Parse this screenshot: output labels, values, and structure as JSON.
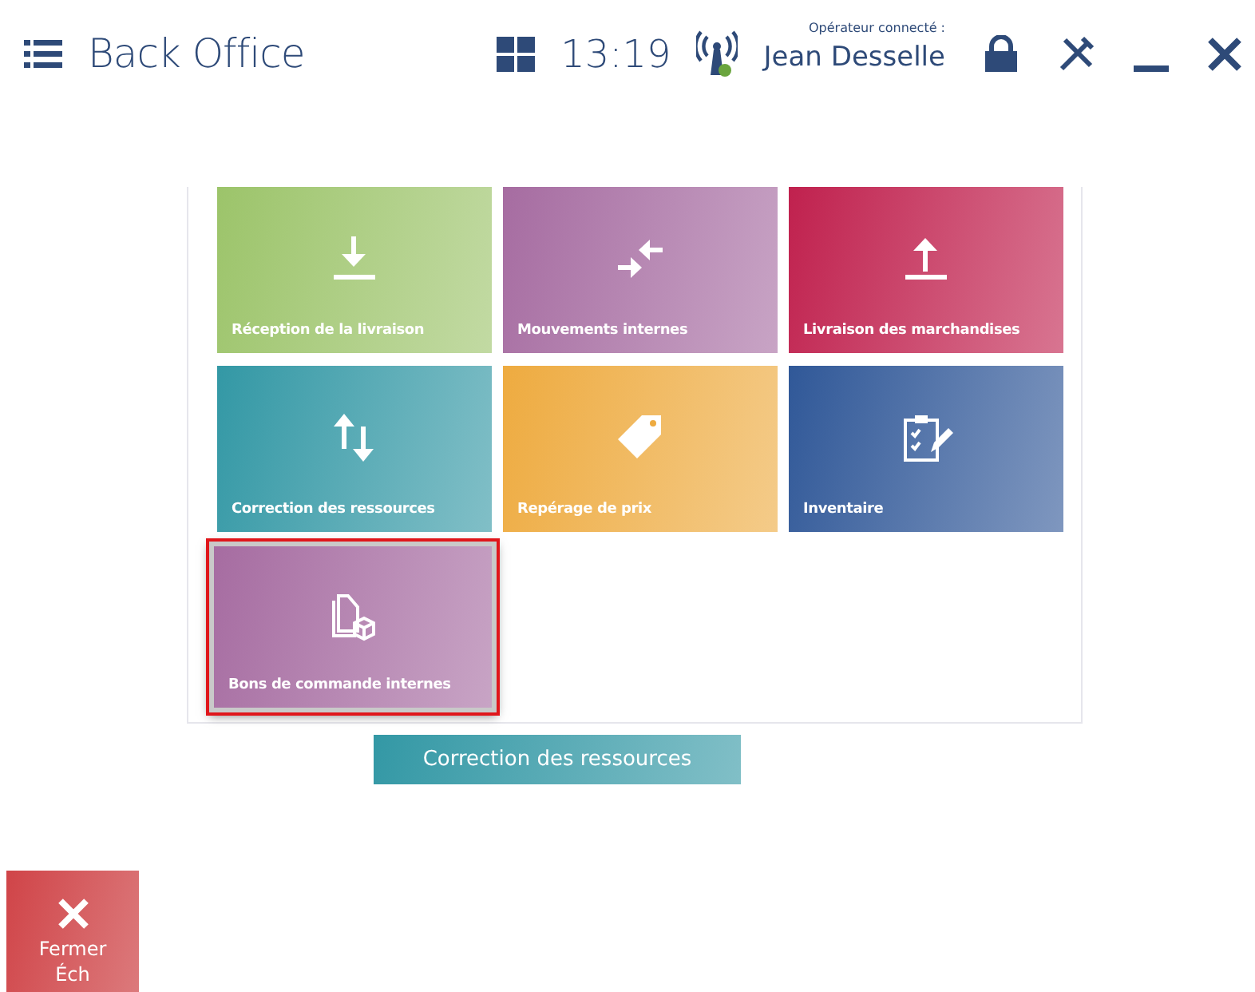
{
  "header": {
    "title": "Back Office",
    "time": "13:19",
    "operator_label": "Opérateur connecté :",
    "operator_name": "Jean Desselle"
  },
  "tiles": [
    {
      "label": "Réception de la livraison",
      "kind": "download",
      "color": "#9cc46a",
      "selected": false
    },
    {
      "label": "Mouvements internes",
      "kind": "transfer",
      "color": "#a66ca1",
      "selected": false
    },
    {
      "label": "Livraison des marchandises",
      "kind": "upload",
      "color": "#c0214e",
      "selected": false
    },
    {
      "label": "Correction des ressources",
      "kind": "updown",
      "color": "#3398a5",
      "selected": false
    },
    {
      "label": "Repérage de prix",
      "kind": "tag",
      "color": "#eeab40",
      "selected": false
    },
    {
      "label": "Inventaire",
      "kind": "clipboard",
      "color": "#305898",
      "selected": false
    },
    {
      "label": "Bons de commande internes",
      "kind": "docs",
      "color": "#a66ca1",
      "selected": true
    }
  ],
  "drag_preview": {
    "label": "Correction des ressources",
    "color": "#3398a5"
  },
  "close_button": {
    "label": "Fermer Éch"
  }
}
